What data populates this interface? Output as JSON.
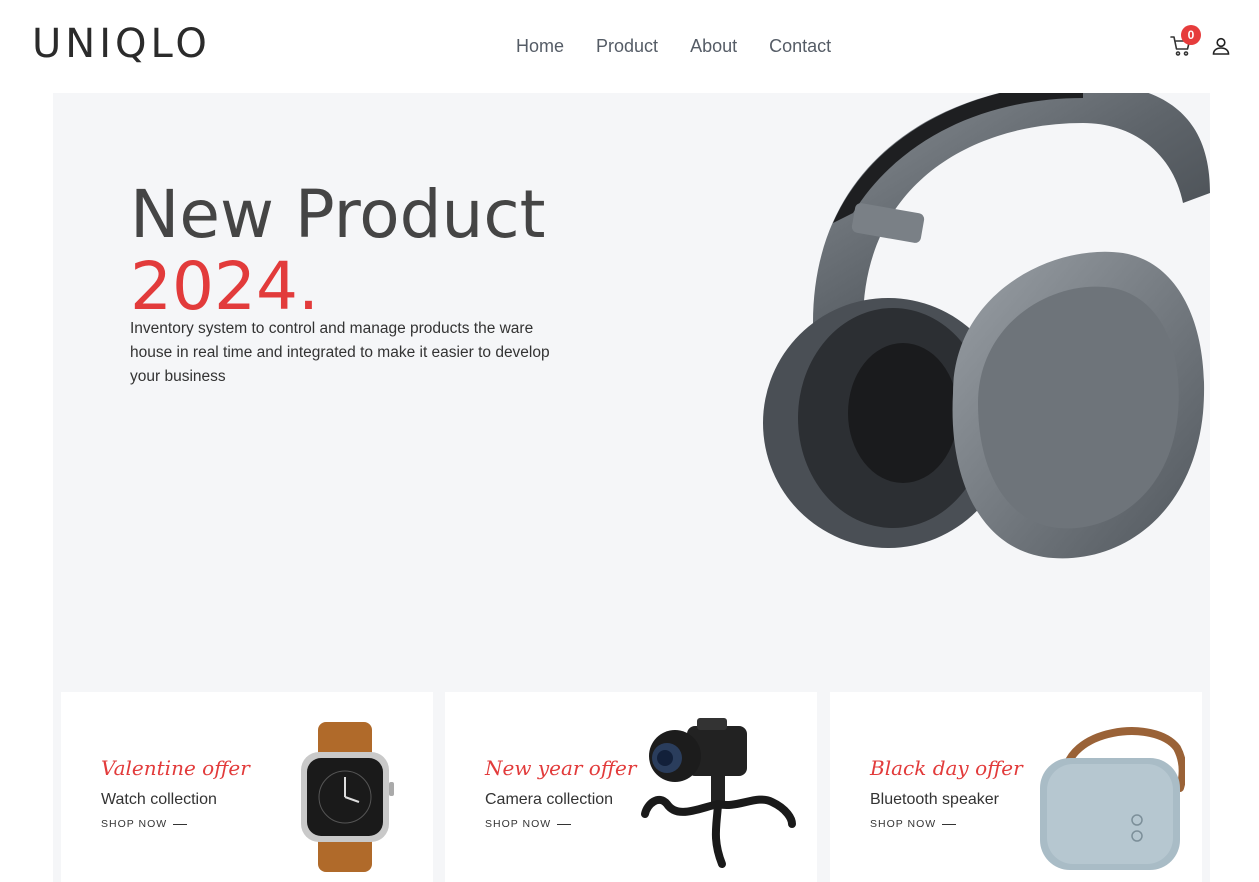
{
  "brand": {
    "logo": "UNIQLO"
  },
  "nav": {
    "home": "Home",
    "product": "Product",
    "about": "About",
    "contact": "Contact"
  },
  "cart": {
    "count": "0"
  },
  "hero": {
    "title": "New Product",
    "year": "2024.",
    "description": "Inventory system to control and manage products the ware house in real time and integrated to make it easier to develop your business"
  },
  "cards": [
    {
      "offer": "Valentine offer",
      "collection": "Watch collection",
      "cta": "SHOP NOW"
    },
    {
      "offer": "New year offer",
      "collection": "Camera collection",
      "cta": "SHOP NOW"
    },
    {
      "offer": "Black day offer",
      "collection": "Bluetooth speaker",
      "cta": "SHOP NOW"
    }
  ],
  "colors": {
    "accent": "#e23b3b",
    "hero_bg": "#f5f6f8",
    "text": "#333333"
  }
}
